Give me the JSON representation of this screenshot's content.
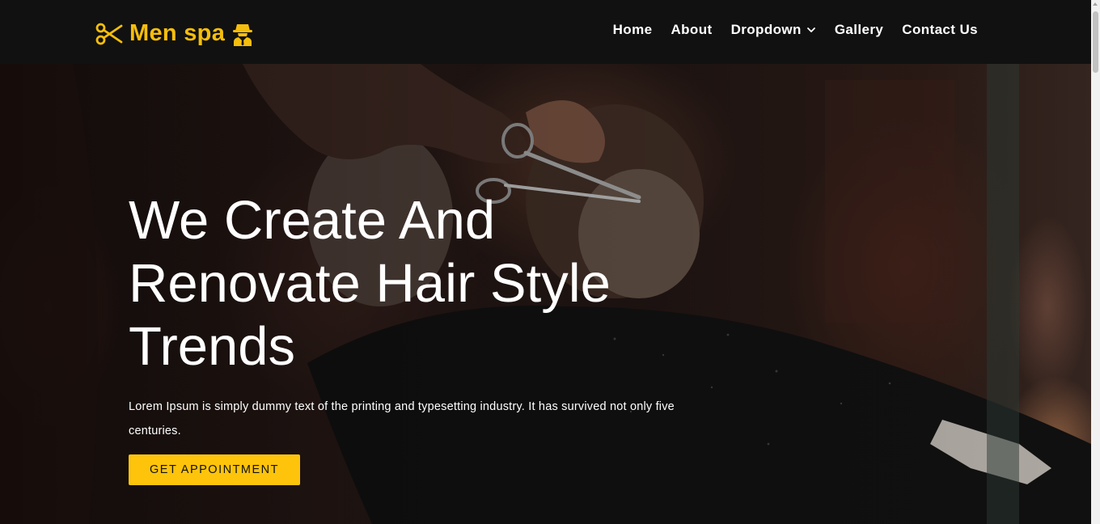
{
  "brand": {
    "name": "Men spa",
    "accent_color": "#f6be0c",
    "icons": [
      "scissors-icon",
      "spy-icon"
    ]
  },
  "nav": {
    "items": [
      {
        "label": "Home"
      },
      {
        "label": "About"
      },
      {
        "label": "Dropdown",
        "icon": "chevron-down-icon"
      },
      {
        "label": "Gallery"
      },
      {
        "label": "Contact Us"
      }
    ]
  },
  "hero": {
    "title": "We Create And Renovate Hair Style Trends",
    "text": "Lorem Ipsum is simply dummy text of the printing and typesetting industry. It has survived not only five centuries.",
    "cta_label": "GET APPOINTMENT",
    "cta_color": "#fdc40b"
  }
}
